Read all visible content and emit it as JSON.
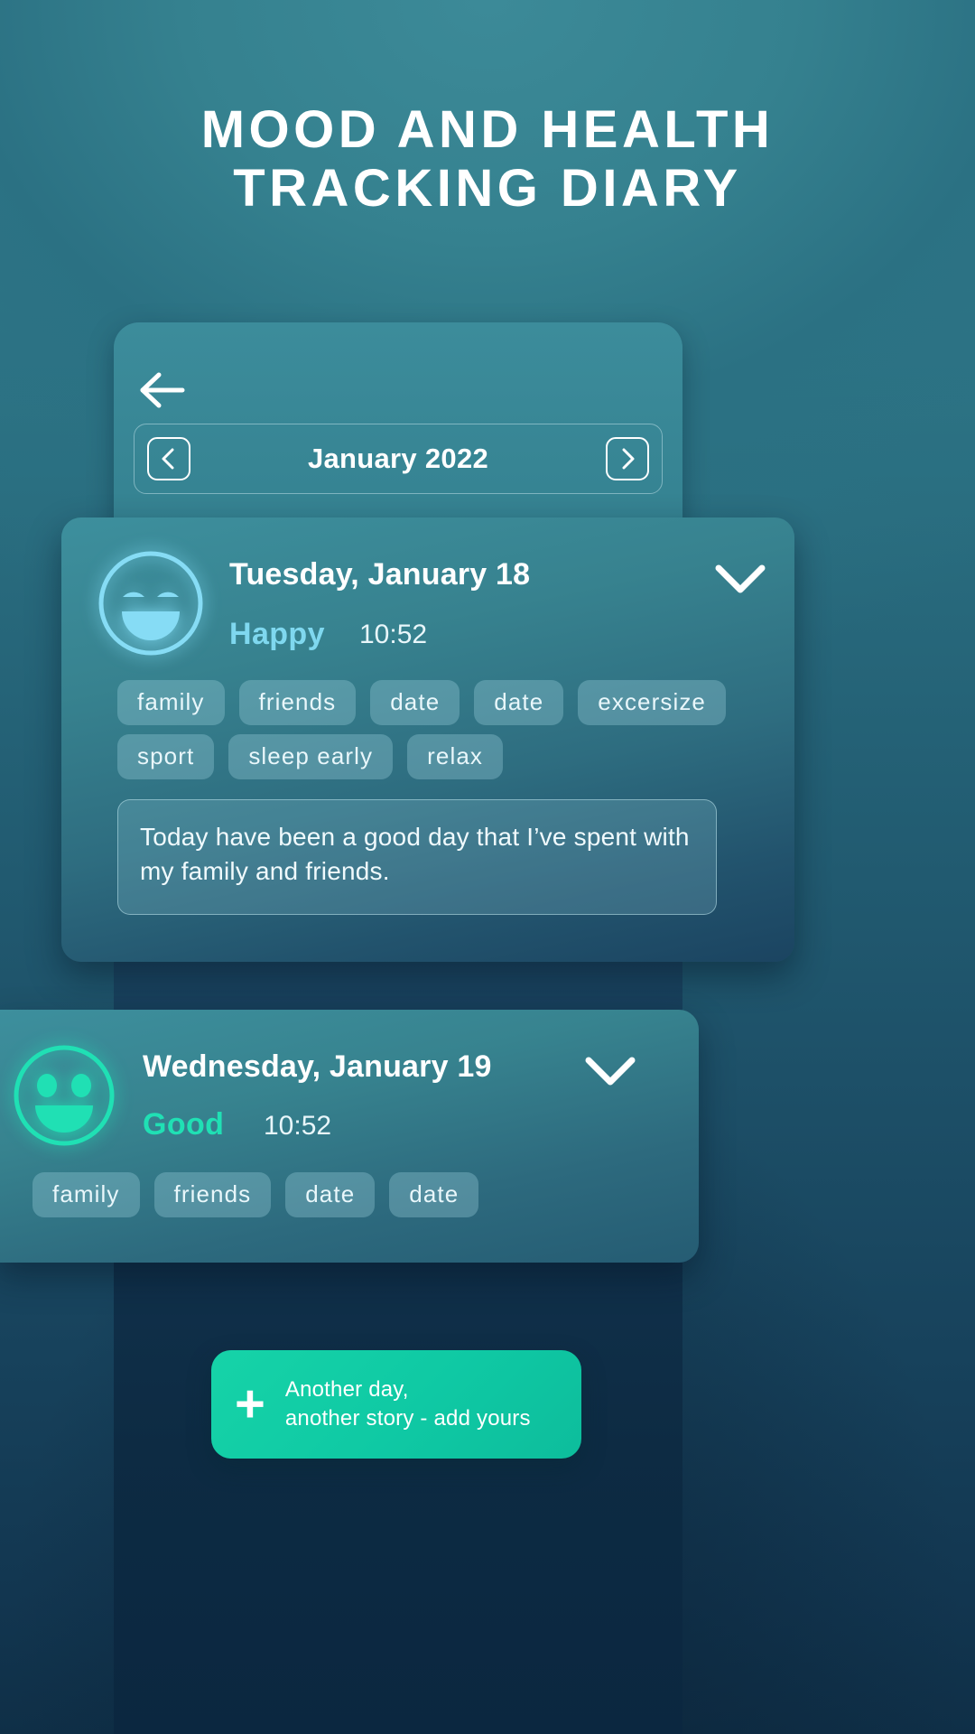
{
  "page": {
    "title_line1": "MOOD AND HEALTH",
    "title_line2": "TRACKING DIARY",
    "background_color": "#2a6e80",
    "accent_green": "#16d3a8",
    "accent_blue": "#7fd8ef"
  },
  "header": {
    "back_icon": "arrow-left-icon",
    "prev_icon": "chevron-left-icon",
    "next_icon": "chevron-right-icon",
    "month_label": "January 2022"
  },
  "entries": [
    {
      "date": "Tuesday, January 18",
      "mood": "Happy",
      "mood_color": "#7fd8ef",
      "time": "10:52",
      "face_icon": "happy-face-icon",
      "expand_icon": "chevron-down-icon",
      "tags_row1": [
        "family",
        "friends",
        "date",
        "date",
        "excersize"
      ],
      "tags_row2": [
        "sport",
        "sleep early",
        "relax"
      ],
      "note": "Today have been a good day that I’ve spent with my family and friends."
    },
    {
      "date": "Wednesday, January 19",
      "mood": "Good",
      "mood_color": "#20e0b4",
      "time": "10:52",
      "face_icon": "good-face-icon",
      "expand_icon": "chevron-down-icon",
      "tags_row1": [
        "family",
        "friends",
        "date",
        "date"
      ]
    }
  ],
  "fab": {
    "plus_icon": "plus-icon",
    "line1": "Another day,",
    "line2": "another story - add yours"
  }
}
